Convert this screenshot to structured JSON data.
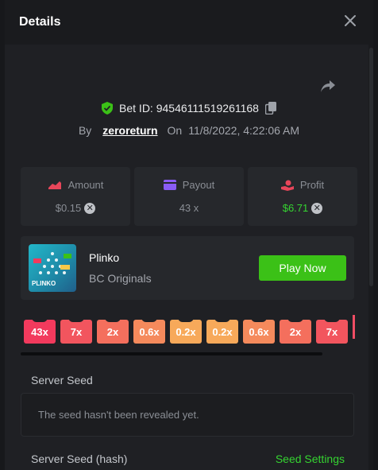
{
  "modal": {
    "title": "Details"
  },
  "bet": {
    "id_label": "Bet ID: 94546111519261168",
    "by_label": "By",
    "user": "zeroreturn",
    "on_label": "On",
    "datetime": "11/8/2022, 4:22:06 AM"
  },
  "stats": {
    "amount": {
      "label": "Amount",
      "value": "$0.15"
    },
    "payout": {
      "label": "Payout",
      "value": "43 x"
    },
    "profit": {
      "label": "Profit",
      "value": "$6.71"
    }
  },
  "game": {
    "name": "Plinko",
    "category": "BC Originals",
    "play_label": "Play Now",
    "thumb_text": "PLINKO"
  },
  "multipliers": [
    {
      "label": "43x",
      "color": "#f23a5d"
    },
    {
      "label": "7x",
      "color": "#f2555e"
    },
    {
      "label": "2x",
      "color": "#f46f5d"
    },
    {
      "label": "0.6x",
      "color": "#f58a5c"
    },
    {
      "label": "0.2x",
      "color": "#f7a95a"
    },
    {
      "label": "0.2x",
      "color": "#f7a95a"
    },
    {
      "label": "0.6x",
      "color": "#f58a5c"
    },
    {
      "label": "2x",
      "color": "#f46f5d"
    },
    {
      "label": "7x",
      "color": "#f2555e"
    }
  ],
  "seeds": {
    "server_seed_label": "Server Seed",
    "server_seed_value": "The seed hasn't been revealed yet.",
    "server_seed_hash_label": "Server Seed (hash)",
    "seed_settings_label": "Seed Settings"
  },
  "colors": {
    "accent_green": "#3bc117",
    "profit_green": "#35d431",
    "amount_icon": "#e8465a",
    "payout_icon": "#8a5cf6",
    "profit_icon": "#e8465a"
  }
}
